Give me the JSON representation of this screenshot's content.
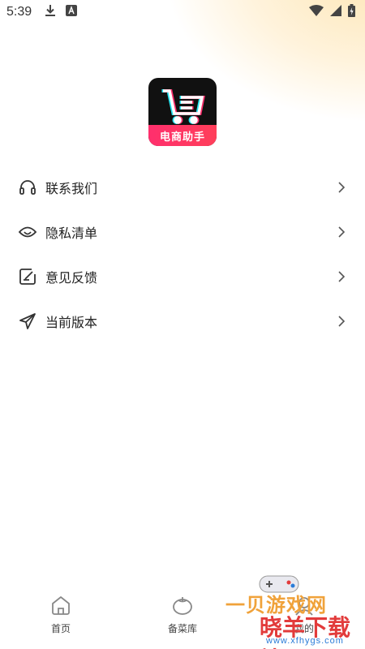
{
  "status_bar": {
    "time": "5:39",
    "left_icons": [
      "download-icon",
      "app-notification-icon"
    ],
    "right_icons": [
      "wifi-icon",
      "signal-icon",
      "battery-icon"
    ]
  },
  "app": {
    "logo_text": "电商助手",
    "logo_colors": {
      "background": "#111111",
      "band": "#ff2f6d",
      "accent_cyan": "#27e3f0",
      "accent_pink": "#ff2f6d"
    }
  },
  "menu": {
    "items": [
      {
        "label": "联系我们",
        "icon": "headphones-icon"
      },
      {
        "label": "隐私清单",
        "icon": "eye-icon"
      },
      {
        "label": "意见反馈",
        "icon": "edit-note-icon"
      },
      {
        "label": "当前版本",
        "icon": "send-icon"
      }
    ]
  },
  "tabbar": {
    "tabs": [
      {
        "label": "首页",
        "icon": "home-icon"
      },
      {
        "label": "备菜库",
        "icon": "tomato-icon"
      },
      {
        "label": "我的",
        "icon": "profile-icon"
      }
    ]
  },
  "watermark": {
    "line1": "一贝游戏网",
    "line2": "晓羊下载站",
    "line3": "www.xfhygs.com"
  }
}
